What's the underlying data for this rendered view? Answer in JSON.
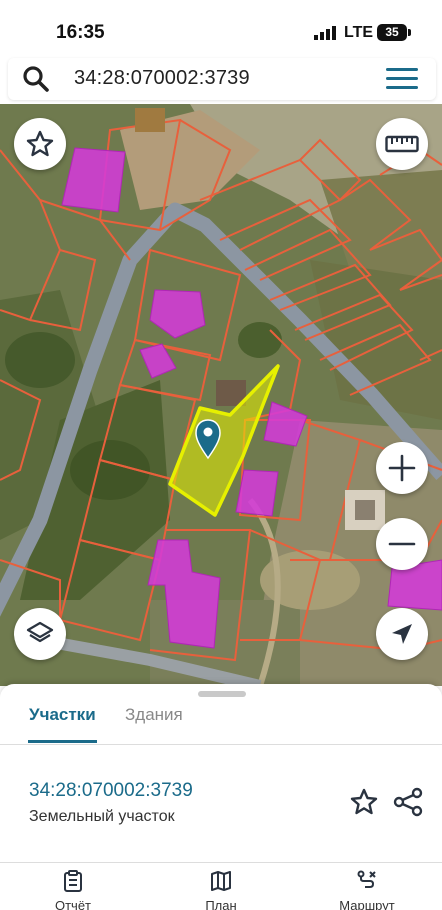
{
  "status_bar": {
    "time": "16:35",
    "network": "LTE",
    "battery": "35"
  },
  "search": {
    "query": "34:28:070002:3739"
  },
  "map": {
    "icons": {
      "favorite": "star-icon",
      "ruler": "ruler-icon",
      "layers": "layers-icon",
      "zoom_in": "plus-icon",
      "zoom_out": "minus-icon",
      "locate": "navigation-arrow-icon",
      "pin": "map-pin-icon"
    },
    "colors": {
      "parcel_border": "#e8603c",
      "selected_parcel": "#e6f000",
      "building": "#d43ad8",
      "road": "#8c96a2"
    }
  },
  "sheet": {
    "tabs": [
      {
        "label": "Участки",
        "active": true
      },
      {
        "label": "Здания",
        "active": false
      }
    ],
    "parcel": {
      "id": "34:28:070002:3739",
      "type": "Земельный участок"
    },
    "nav": [
      {
        "label": "Отчёт",
        "icon": "report-icon"
      },
      {
        "label": "План",
        "icon": "map-icon"
      },
      {
        "label": "Маршрут",
        "icon": "route-icon"
      }
    ]
  }
}
